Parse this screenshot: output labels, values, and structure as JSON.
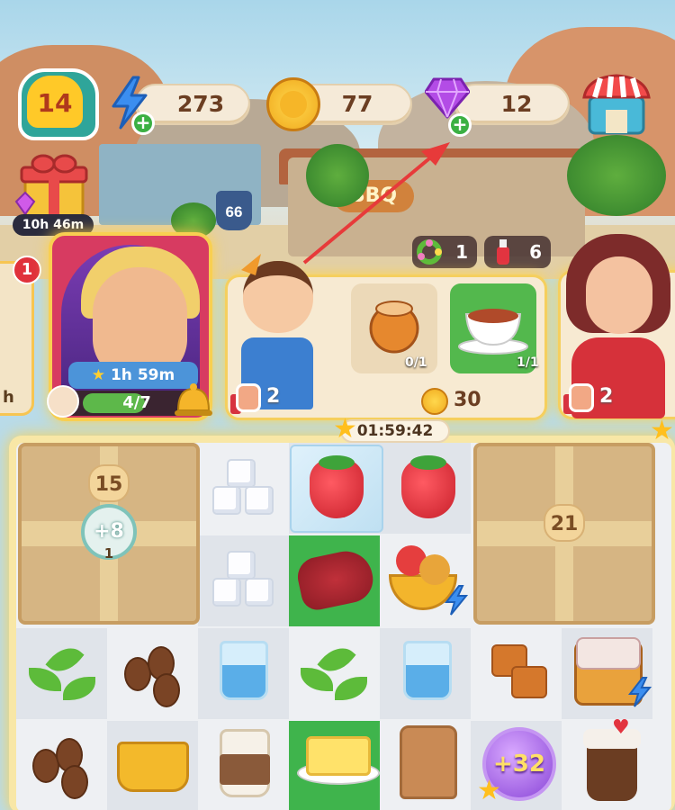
{
  "hud": {
    "level": "14",
    "energy": "273",
    "coins": "77",
    "gems": "12",
    "gift_timer": "10h 46m"
  },
  "inventory": {
    "wreath_count": "1",
    "sauce_count": "6"
  },
  "customers": {
    "notification_count": "1",
    "left_card_label": "h",
    "chef": {
      "timer": "1h 59m",
      "progress_text": "4/7",
      "progress_value": 0.571
    },
    "order": {
      "items": [
        {
          "icon": "soup-pot-icon",
          "progress": "0/1",
          "complete": false
        },
        {
          "icon": "tea-cup-icon",
          "progress": "1/1",
          "complete": true
        }
      ],
      "likes": "2",
      "reward_coins": "30"
    },
    "right_likes": "2"
  },
  "board": {
    "event_timer": "01:59:42",
    "crate_left_level": "15",
    "crate_right_level": "21",
    "boost_label": "+8",
    "boost_count": "1",
    "bubble_label": "+32"
  },
  "scene": {
    "route_sign": "66",
    "bbq_sign": "BBQ"
  },
  "colors": {
    "board_bg": "#eef0f3",
    "highlight_green": "#3fb44c",
    "accent_gold": "#ffbf1e"
  }
}
